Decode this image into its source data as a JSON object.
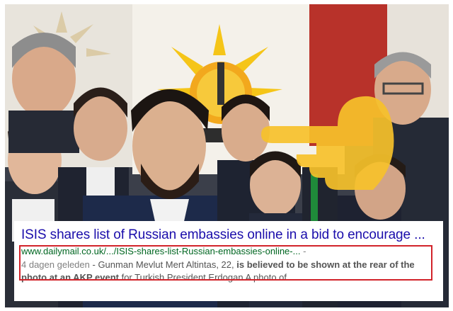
{
  "search_result": {
    "title": "ISIS shares list of Russian embassies online in a bid to encourage ...",
    "url": "www.dailymail.co.uk/.../ISIS-shares-list-Russian-embassies-online-...",
    "url_suffix": "-",
    "date": "4 dagen geleden",
    "snippet_sep": " - ",
    "snippet_part1": "Gunman Mevlut Mert Altintas, 22, ",
    "snippet_bold": "is believed to be shown at the rear of the photo at an AKP event",
    "snippet_part2": " for Turkish President Erdogan A photo of ..."
  },
  "colors": {
    "title": "#1a0dab",
    "url": "#006621",
    "snippet": "#545454",
    "highlight_border": "#d2232a",
    "pointer_hand": "#f6c12a",
    "akp_sun": "#f5c518"
  },
  "icons": {
    "pointer": "pointing-hand-icon",
    "logo": "akp-party-logo-icon"
  }
}
